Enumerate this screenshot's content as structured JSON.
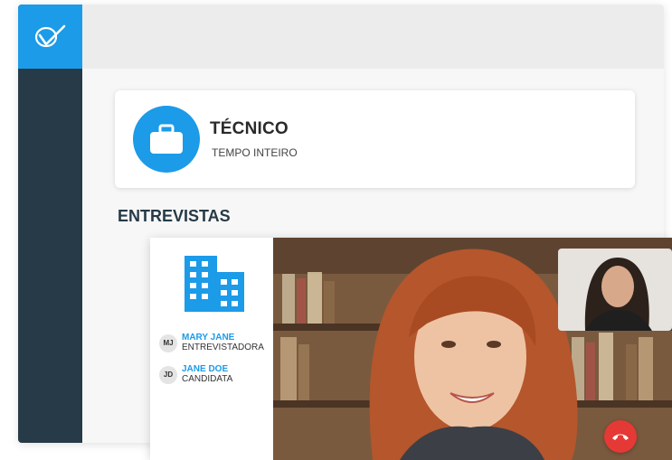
{
  "job": {
    "title": "TÉCNICO",
    "type": "TEMPO INTEIRO",
    "icon": "briefcase-icon"
  },
  "interviews": {
    "section_title": "ENTREVISTAS",
    "participants": [
      {
        "initials": "MJ",
        "name": "MARY JANE",
        "role": "ENTREVISTADORA"
      },
      {
        "initials": "JD",
        "name": "JANE DOE",
        "role": "CANDIDATA"
      }
    ]
  },
  "colors": {
    "accent": "#1b9be8",
    "sidebar": "#263a47",
    "hangup": "#e53935"
  }
}
